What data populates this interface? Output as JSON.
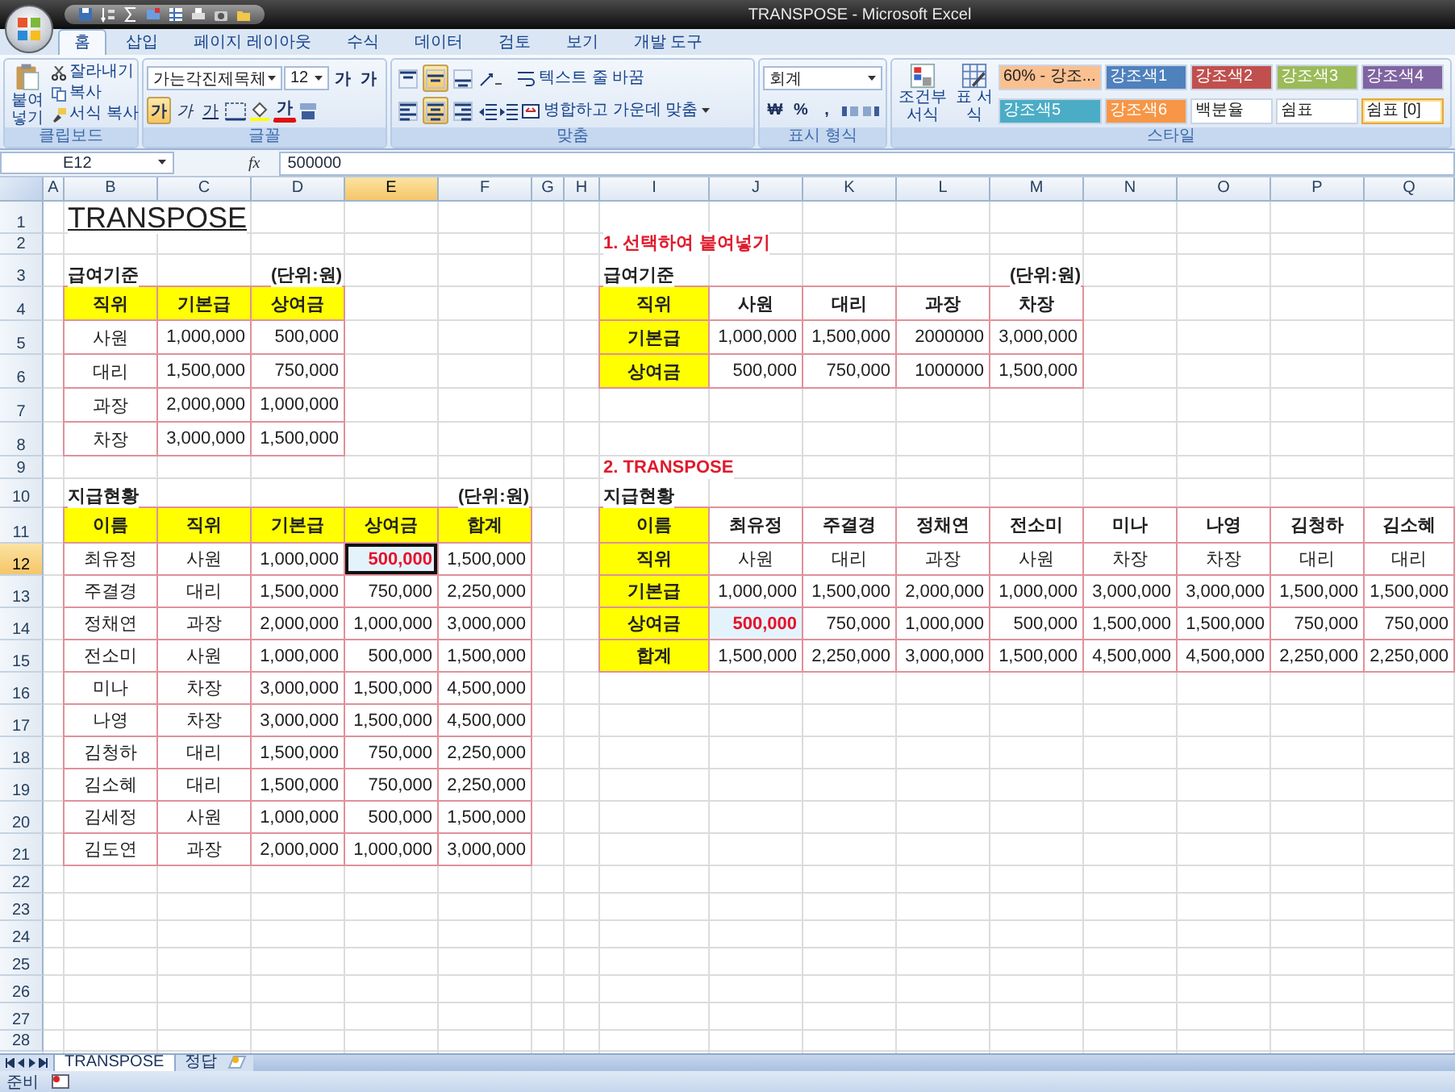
{
  "window": {
    "title": "TRANSPOSE - Microsoft Excel"
  },
  "ribbon_tabs": [
    {
      "label": "홈",
      "selected": true
    },
    {
      "label": "삽입",
      "selected": false
    },
    {
      "label": "페이지 레이아웃",
      "selected": false
    },
    {
      "label": "수식",
      "selected": false
    },
    {
      "label": "데이터",
      "selected": false
    },
    {
      "label": "검토",
      "selected": false
    },
    {
      "label": "보기",
      "selected": false
    },
    {
      "label": "개발 도구",
      "selected": false
    }
  ],
  "ribbon": {
    "clipboard": {
      "label": "클립보드",
      "paste": "붙여넣기",
      "items": [
        "잘라내기",
        "복사",
        "서식 복사"
      ]
    },
    "font": {
      "label": "글꼴",
      "name": "가는각진제목체",
      "size": "12",
      "grow": "가",
      "shrink": "가",
      "color_button": "가",
      "styles": [
        {
          "label": "가",
          "kind": "bold",
          "on": true
        },
        {
          "label": "가",
          "kind": "italic",
          "on": false
        },
        {
          "label": "가",
          "kind": "underline",
          "on": false
        }
      ]
    },
    "alignment": {
      "label": "맞춤",
      "wrap": "텍스트 줄 바꿈",
      "merge": "병합하고 가운데 맞춤",
      "vertical": [
        {
          "kind": "top",
          "on": false
        },
        {
          "kind": "middle",
          "on": true
        },
        {
          "kind": "bottom",
          "on": false
        }
      ],
      "horizontal": [
        {
          "kind": "left",
          "on": false
        },
        {
          "kind": "center",
          "on": true
        },
        {
          "kind": "right",
          "on": false
        }
      ]
    },
    "number": {
      "label": "표시 형식",
      "format": "회계",
      "currency": "₩",
      "percent": "%",
      "comma": ","
    },
    "styles": {
      "label": "스타일",
      "conditional": "조건부 서식",
      "table": "표 서식",
      "cell_styles": [
        {
          "label": "60% - 강조...",
          "color": "#fac090",
          "selected": false
        },
        {
          "label": "강조색1",
          "color": "#4f81bd",
          "selected": false
        },
        {
          "label": "강조색2",
          "color": "#c0504d",
          "selected": false
        },
        {
          "label": "강조색3",
          "color": "#9bbb59",
          "selected": false
        },
        {
          "label": "강조색4",
          "color": "#8064a2",
          "selected": false
        },
        {
          "label": "강조색5",
          "color": "#4bacc6",
          "selected": false
        },
        {
          "label": "강조색6",
          "color": "#f79646",
          "selected": false
        },
        {
          "label": "백분율",
          "color": "#ffffff",
          "selected": false
        },
        {
          "label": "쉼표",
          "color": "#ffffff",
          "selected": false
        },
        {
          "label": "쉼표 [0]",
          "color": "#ffffff",
          "selected": true
        }
      ]
    }
  },
  "formula_bar": {
    "name_box": "E12",
    "function_button": "fx",
    "formula": "500000"
  },
  "sheet": {
    "columns": [
      {
        "label": "A",
        "selected": false
      },
      {
        "label": "B",
        "selected": false
      },
      {
        "label": "C",
        "selected": false
      },
      {
        "label": "D",
        "selected": false
      },
      {
        "label": "E",
        "selected": true
      },
      {
        "label": "F",
        "selected": false
      },
      {
        "label": "G",
        "selected": false
      },
      {
        "label": "H",
        "selected": false
      },
      {
        "label": "I",
        "selected": false
      },
      {
        "label": "J",
        "selected": false
      },
      {
        "label": "K",
        "selected": false
      },
      {
        "label": "L",
        "selected": false
      },
      {
        "label": "M",
        "selected": false
      },
      {
        "label": "N",
        "selected": false
      },
      {
        "label": "O",
        "selected": false
      },
      {
        "label": "P",
        "selected": false
      },
      {
        "label": "Q",
        "selected": false
      }
    ],
    "rows": [
      {
        "label": "1",
        "selected": false,
        "cells": [
          null,
          {
            "kind": "title",
            "text": "TRANSPOSE"
          }
        ]
      },
      {
        "label": "2",
        "selected": false,
        "cells": [
          null,
          null,
          null,
          null,
          null,
          null,
          null,
          null,
          {
            "kind": "heading",
            "text": "1. 선택하여 붙여넣기"
          }
        ]
      },
      {
        "label": "3",
        "selected": false,
        "cells": [
          null,
          {
            "kind": "label",
            "text": "급여기준"
          },
          null,
          {
            "kind": "unit",
            "text": "(단위:원)"
          },
          null,
          null,
          null,
          null,
          {
            "kind": "label",
            "text": "급여기준"
          },
          null,
          null,
          null,
          {
            "kind": "unit",
            "text": "(단위:원)"
          }
        ]
      },
      {
        "label": "4",
        "selected": false,
        "cells": [
          null,
          {
            "kind": "header",
            "text": "직위"
          },
          {
            "kind": "header",
            "text": "기본급"
          },
          {
            "kind": "header",
            "text": "상여금"
          },
          null,
          null,
          null,
          null,
          {
            "kind": "header",
            "text": "직위"
          },
          {
            "kind": "colhead",
            "text": "사원"
          },
          {
            "kind": "colhead",
            "text": "대리"
          },
          {
            "kind": "colhead",
            "text": "과장"
          },
          {
            "kind": "colhead",
            "text": "차장"
          }
        ]
      },
      {
        "label": "5",
        "selected": false,
        "cells": [
          null,
          {
            "kind": "text",
            "text": "사원"
          },
          {
            "kind": "number",
            "text": "1,000,000"
          },
          {
            "kind": "number",
            "text": "500,000"
          },
          null,
          null,
          null,
          null,
          {
            "kind": "header",
            "text": "기본급"
          },
          {
            "kind": "number",
            "text": "1,000,000"
          },
          {
            "kind": "number",
            "text": "1,500,000"
          },
          {
            "kind": "number",
            "text": "2000000"
          },
          {
            "kind": "number",
            "text": "3,000,000"
          }
        ]
      },
      {
        "label": "6",
        "selected": false,
        "cells": [
          null,
          {
            "kind": "text",
            "text": "대리"
          },
          {
            "kind": "number",
            "text": "1,500,000"
          },
          {
            "kind": "number",
            "text": "750,000"
          },
          null,
          null,
          null,
          null,
          {
            "kind": "header",
            "text": "상여금"
          },
          {
            "kind": "number",
            "text": "500,000"
          },
          {
            "kind": "number",
            "text": "750,000"
          },
          {
            "kind": "number",
            "text": "1000000"
          },
          {
            "kind": "number",
            "text": "1,500,000"
          }
        ]
      },
      {
        "label": "7",
        "selected": false,
        "cells": [
          null,
          {
            "kind": "text",
            "text": "과장"
          },
          {
            "kind": "number",
            "text": "2,000,000"
          },
          {
            "kind": "number",
            "text": "1,000,000"
          }
        ]
      },
      {
        "label": "8",
        "selected": false,
        "cells": [
          null,
          {
            "kind": "text",
            "text": "차장"
          },
          {
            "kind": "number",
            "text": "3,000,000"
          },
          {
            "kind": "number",
            "text": "1,500,000"
          }
        ]
      },
      {
        "label": "9",
        "selected": false,
        "cells": [
          null,
          null,
          null,
          null,
          null,
          null,
          null,
          null,
          {
            "kind": "heading",
            "text": "2. TRANSPOSE"
          }
        ]
      },
      {
        "label": "10",
        "selected": false,
        "cells": [
          null,
          {
            "kind": "label",
            "text": "지급현황"
          },
          null,
          null,
          null,
          {
            "kind": "unit",
            "text": "(단위:원)"
          },
          null,
          null,
          {
            "kind": "label",
            "text": "지급현황"
          }
        ]
      },
      {
        "label": "11",
        "selected": false,
        "cells": [
          null,
          {
            "kind": "header",
            "text": "이름"
          },
          {
            "kind": "header",
            "text": "직위"
          },
          {
            "kind": "header",
            "text": "기본급"
          },
          {
            "kind": "header",
            "text": "상여금"
          },
          {
            "kind": "header",
            "text": "합계"
          },
          null,
          null,
          {
            "kind": "header",
            "text": "이름"
          },
          {
            "kind": "colhead",
            "text": "최유정"
          },
          {
            "kind": "colhead",
            "text": "주결경"
          },
          {
            "kind": "colhead",
            "text": "정채연"
          },
          {
            "kind": "colhead",
            "text": "전소미"
          },
          {
            "kind": "colhead",
            "text": "미나"
          },
          {
            "kind": "colhead",
            "text": "나영"
          },
          {
            "kind": "colhead",
            "text": "김청하"
          },
          {
            "kind": "colhead",
            "text": "김소혜"
          }
        ]
      },
      {
        "label": "12",
        "selected": true,
        "cells": [
          null,
          {
            "kind": "text",
            "text": "최유정"
          },
          {
            "kind": "text",
            "text": "사원"
          },
          {
            "kind": "number",
            "text": "1,000,000"
          },
          {
            "kind": "emphasis",
            "text": "500,000"
          },
          {
            "kind": "number",
            "text": "1,500,000"
          },
          null,
          null,
          {
            "kind": "header",
            "text": "직위"
          },
          {
            "kind": "text",
            "text": "사원"
          },
          {
            "kind": "text",
            "text": "대리"
          },
          {
            "kind": "text",
            "text": "과장"
          },
          {
            "kind": "text",
            "text": "사원"
          },
          {
            "kind": "text",
            "text": "차장"
          },
          {
            "kind": "text",
            "text": "차장"
          },
          {
            "kind": "text",
            "text": "대리"
          },
          {
            "kind": "text",
            "text": "대리"
          }
        ]
      },
      {
        "label": "13",
        "selected": false,
        "cells": [
          null,
          {
            "kind": "text",
            "text": "주결경"
          },
          {
            "kind": "text",
            "text": "대리"
          },
          {
            "kind": "number",
            "text": "1,500,000"
          },
          {
            "kind": "number",
            "text": "750,000"
          },
          {
            "kind": "number",
            "text": "2,250,000"
          },
          null,
          null,
          {
            "kind": "header",
            "text": "기본급"
          },
          {
            "kind": "number",
            "text": "1,000,000"
          },
          {
            "kind": "number",
            "text": "1,500,000"
          },
          {
            "kind": "number",
            "text": "2,000,000"
          },
          {
            "kind": "number",
            "text": "1,000,000"
          },
          {
            "kind": "number",
            "text": "3,000,000"
          },
          {
            "kind": "number",
            "text": "3,000,000"
          },
          {
            "kind": "number",
            "text": "1,500,000"
          },
          {
            "kind": "number",
            "text": "1,500,000"
          }
        ]
      },
      {
        "label": "14",
        "selected": false,
        "cells": [
          null,
          {
            "kind": "text",
            "text": "정채연"
          },
          {
            "kind": "text",
            "text": "과장"
          },
          {
            "kind": "number",
            "text": "2,000,000"
          },
          {
            "kind": "number",
            "text": "1,000,000"
          },
          {
            "kind": "number",
            "text": "3,000,000"
          },
          null,
          null,
          {
            "kind": "header",
            "text": "상여금"
          },
          {
            "kind": "emphasis",
            "text": "500,000"
          },
          {
            "kind": "number",
            "text": "750,000"
          },
          {
            "kind": "number",
            "text": "1,000,000"
          },
          {
            "kind": "number",
            "text": "500,000"
          },
          {
            "kind": "number",
            "text": "1,500,000"
          },
          {
            "kind": "number",
            "text": "1,500,000"
          },
          {
            "kind": "number",
            "text": "750,000"
          },
          {
            "kind": "number",
            "text": "750,000"
          }
        ]
      },
      {
        "label": "15",
        "selected": false,
        "cells": [
          null,
          {
            "kind": "text",
            "text": "전소미"
          },
          {
            "kind": "text",
            "text": "사원"
          },
          {
            "kind": "number",
            "text": "1,000,000"
          },
          {
            "kind": "number",
            "text": "500,000"
          },
          {
            "kind": "number",
            "text": "1,500,000"
          },
          null,
          null,
          {
            "kind": "header",
            "text": "합계"
          },
          {
            "kind": "number",
            "text": "1,500,000"
          },
          {
            "kind": "number",
            "text": "2,250,000"
          },
          {
            "kind": "number",
            "text": "3,000,000"
          },
          {
            "kind": "number",
            "text": "1,500,000"
          },
          {
            "kind": "number",
            "text": "4,500,000"
          },
          {
            "kind": "number",
            "text": "4,500,000"
          },
          {
            "kind": "number",
            "text": "2,250,000"
          },
          {
            "kind": "number",
            "text": "2,250,000"
          }
        ]
      },
      {
        "label": "16",
        "selected": false,
        "cells": [
          null,
          {
            "kind": "text",
            "text": "미나"
          },
          {
            "kind": "text",
            "text": "차장"
          },
          {
            "kind": "number",
            "text": "3,000,000"
          },
          {
            "kind": "number",
            "text": "1,500,000"
          },
          {
            "kind": "number",
            "text": "4,500,000"
          }
        ]
      },
      {
        "label": "17",
        "selected": false,
        "cells": [
          null,
          {
            "kind": "text",
            "text": "나영"
          },
          {
            "kind": "text",
            "text": "차장"
          },
          {
            "kind": "number",
            "text": "3,000,000"
          },
          {
            "kind": "number",
            "text": "1,500,000"
          },
          {
            "kind": "number",
            "text": "4,500,000"
          }
        ]
      },
      {
        "label": "18",
        "selected": false,
        "cells": [
          null,
          {
            "kind": "text",
            "text": "김청하"
          },
          {
            "kind": "text",
            "text": "대리"
          },
          {
            "kind": "number",
            "text": "1,500,000"
          },
          {
            "kind": "number",
            "text": "750,000"
          },
          {
            "kind": "number",
            "text": "2,250,000"
          }
        ]
      },
      {
        "label": "19",
        "selected": false,
        "cells": [
          null,
          {
            "kind": "text",
            "text": "김소혜"
          },
          {
            "kind": "text",
            "text": "대리"
          },
          {
            "kind": "number",
            "text": "1,500,000"
          },
          {
            "kind": "number",
            "text": "750,000"
          },
          {
            "kind": "number",
            "text": "2,250,000"
          }
        ]
      },
      {
        "label": "20",
        "selected": false,
        "cells": [
          null,
          {
            "kind": "text",
            "text": "김세정"
          },
          {
            "kind": "text",
            "text": "사원"
          },
          {
            "kind": "number",
            "text": "1,000,000"
          },
          {
            "kind": "number",
            "text": "500,000"
          },
          {
            "kind": "number",
            "text": "1,500,000"
          }
        ]
      },
      {
        "label": "21",
        "selected": false,
        "cells": [
          null,
          {
            "kind": "text",
            "text": "김도연"
          },
          {
            "kind": "text",
            "text": "과장"
          },
          {
            "kind": "number",
            "text": "2,000,000"
          },
          {
            "kind": "number",
            "text": "1,000,000"
          },
          {
            "kind": "number",
            "text": "3,000,000"
          }
        ]
      },
      {
        "label": "22",
        "selected": false
      },
      {
        "label": "23",
        "selected": false
      },
      {
        "label": "24",
        "selected": false
      },
      {
        "label": "25",
        "selected": false
      },
      {
        "label": "26",
        "selected": false
      },
      {
        "label": "27",
        "selected": false
      },
      {
        "label": "28",
        "selected": false
      }
    ]
  },
  "sheet_tabs": [
    {
      "label": "TRANSPOSE",
      "selected": true
    },
    {
      "label": "정답",
      "selected": false
    }
  ],
  "status_bar": {
    "text": "준비"
  }
}
